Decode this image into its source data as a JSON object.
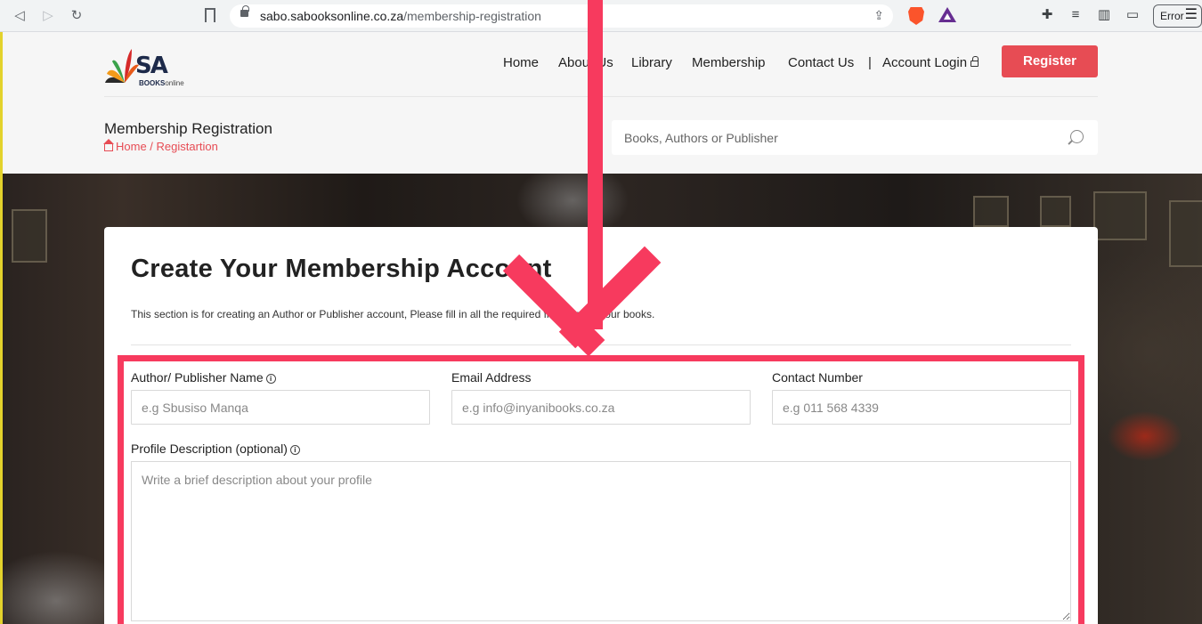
{
  "browser": {
    "url_domain": "sabo.sabooksonline.co.za",
    "url_path": "/membership-registration",
    "error_label": "Error"
  },
  "site": {
    "logo": {
      "initials_s": "S",
      "initials_a": "A",
      "books": "BOOKS",
      "online": "online"
    },
    "nav": {
      "home": "Home",
      "about": "About Us",
      "library": "Library",
      "membership": "Membership",
      "contact": "Contact Us",
      "separator": "|",
      "account_login": "Account Login"
    },
    "register_label": "Register",
    "page_title": "Membership Registration",
    "breadcrumb": "Home / Registartion",
    "search_placeholder": "Books, Authors or Publisher"
  },
  "form": {
    "title": "Create Your Membership Account",
    "description": "This section is for creating an Author or Publisher account, Please fill in all the required fields to list your books.",
    "fields": {
      "name_label": "Author/ Publisher Name",
      "name_placeholder": "e.g Sbusiso Manqa",
      "email_label": "Email Address",
      "email_placeholder": "e.g info@inyanibooks.co.za",
      "contact_label": "Contact Number",
      "contact_placeholder": "e.g 011 568 4339",
      "profile_label": "Profile Description (optional)",
      "profile_placeholder": "Write a brief description about your profile"
    },
    "info_glyph": "i"
  },
  "colors": {
    "accent_red": "#e74c54",
    "annotation_pink": "#f73a5e"
  }
}
